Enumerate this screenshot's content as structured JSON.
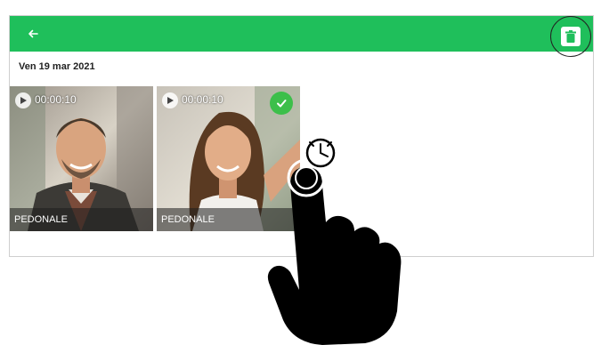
{
  "colors": {
    "toolbar": "#1fbf5b",
    "check": "#3cbf4a"
  },
  "toolbar": {
    "back_icon": "arrow-left-icon",
    "delete_icon": "trash-icon"
  },
  "gallery": {
    "date": "Ven 19 mar 2021",
    "items": [
      {
        "duration": "00:00:10",
        "label": "PEDONALE",
        "selected": false
      },
      {
        "duration": "00:00:10",
        "label": "PEDONALE",
        "selected": true
      }
    ]
  },
  "gesture": {
    "type": "long-press",
    "icons": [
      "hand-pointer-icon",
      "clock-icon"
    ]
  }
}
